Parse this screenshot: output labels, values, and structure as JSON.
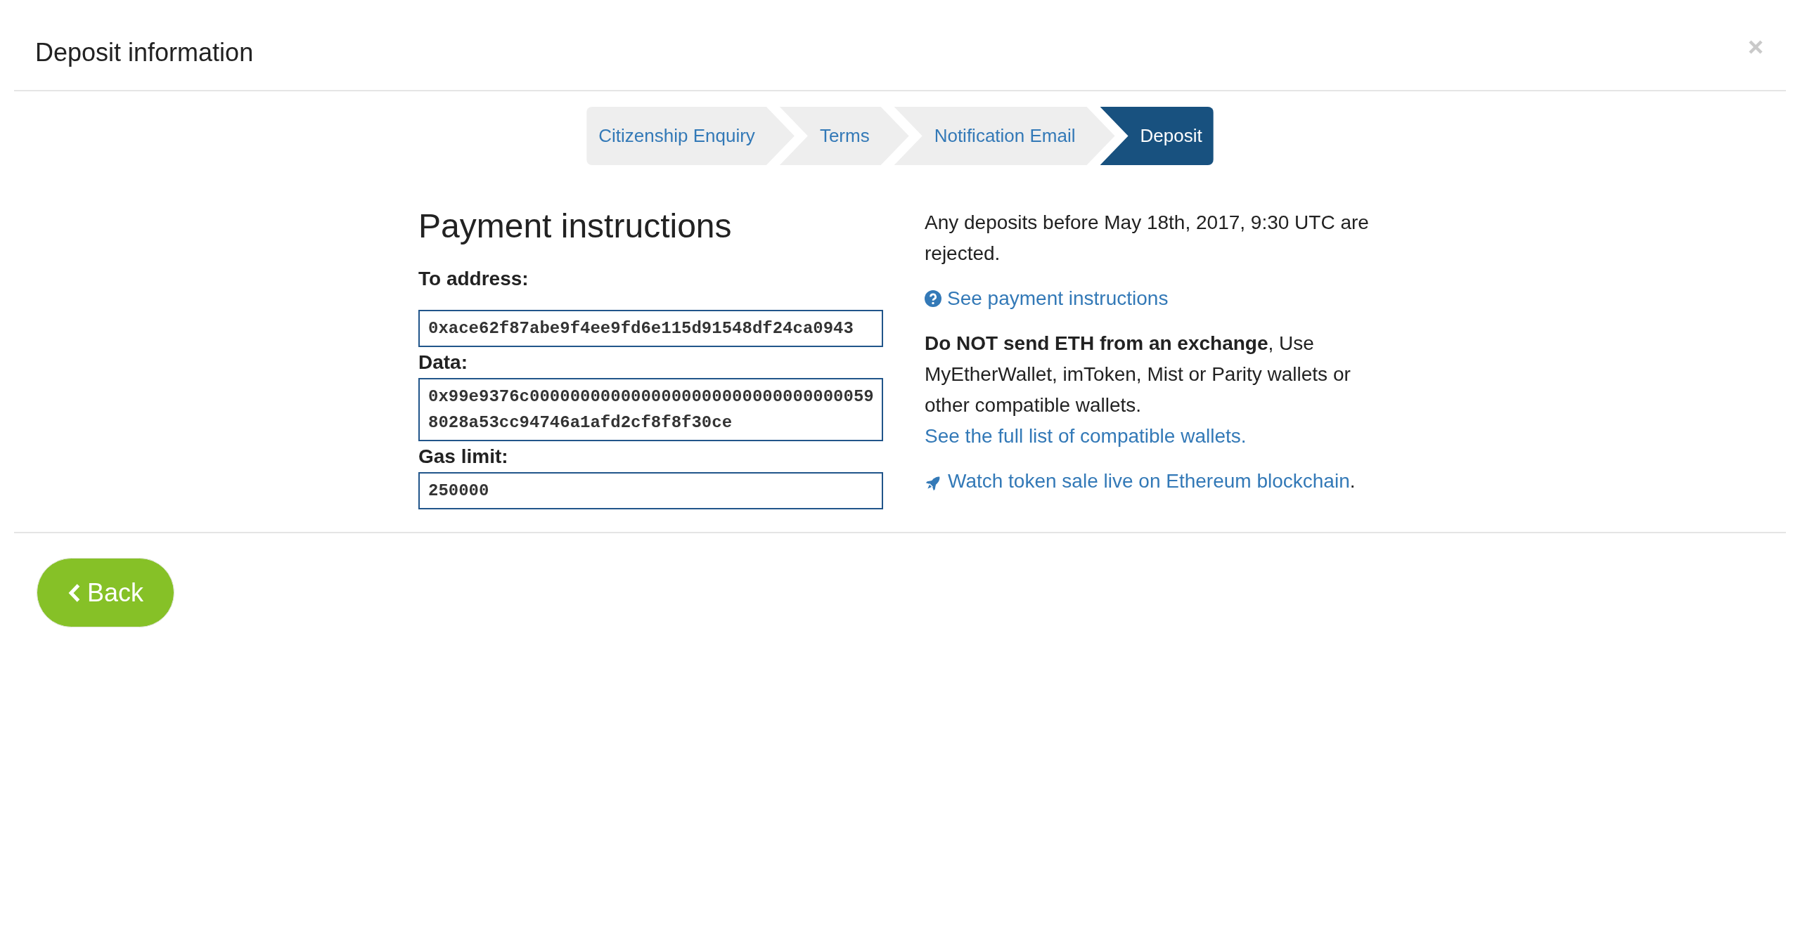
{
  "dialog": {
    "title": "Deposit information"
  },
  "steps": [
    {
      "label": "Citizenship Enquiry",
      "selected": false
    },
    {
      "label": "Terms",
      "selected": false
    },
    {
      "label": "Notification Email",
      "selected": false
    },
    {
      "label": "Deposit",
      "selected": true
    }
  ],
  "payment": {
    "heading": "Payment instructions",
    "fields": [
      {
        "label": "To address:",
        "value": "0xace62f87abe9f4ee9fd6e115d91548df24ca0943"
      },
      {
        "label": "Data:",
        "value": "0x99e9376c00000000000000000000000000000000598028a53cc94746a1afd2cf8f8f30ce"
      },
      {
        "label": "Gas limit:",
        "value": "250000"
      }
    ]
  },
  "info": {
    "notice": "Any deposits before May 18th, 2017, 9:30 UTC are rejected.",
    "help_link": "See payment instructions",
    "warning": {
      "text": "**Do NOT send ETH from an exchange**, Use MyEtherWallet, imToken, Mist or Parity wallets or other compatible wallets.",
      "link": "See the full list of compatible wallets."
    },
    "watch": {
      "link": "Watch token sale live on Ethereum blockchain",
      "suffix": "."
    }
  },
  "footer": {
    "back": "Back"
  }
}
